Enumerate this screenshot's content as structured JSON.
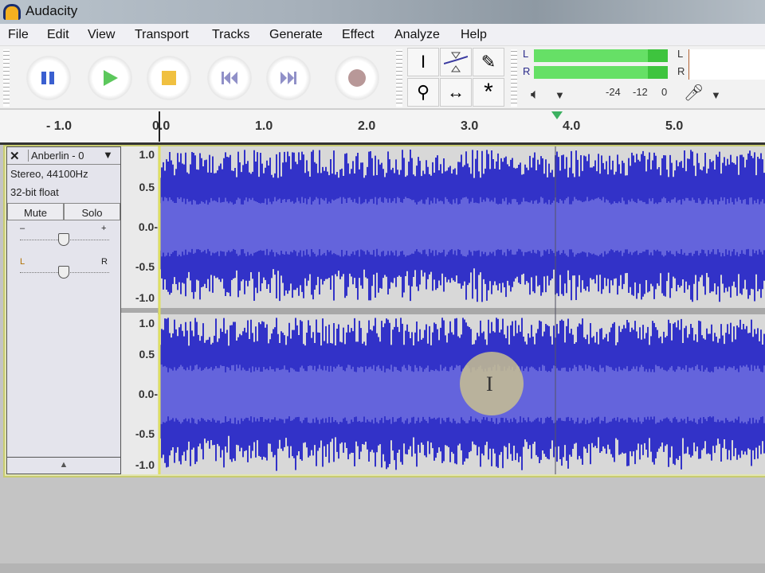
{
  "window": {
    "title": "Audacity"
  },
  "menu": [
    "File",
    "Edit",
    "View",
    "Transport",
    "Tracks",
    "Generate",
    "Effect",
    "Analyze",
    "Help"
  ],
  "transport": {
    "pause": "pause",
    "play": "play",
    "stop": "stop",
    "skip_start": "skip-to-start",
    "skip_end": "skip-to-end",
    "record": "record"
  },
  "tools": [
    "selection",
    "envelope",
    "draw",
    "zoom",
    "time-shift",
    "multi"
  ],
  "meter": {
    "play_L": "L",
    "play_R": "R",
    "rec_L": "L",
    "rec_R": "R",
    "scale": [
      "-24",
      "-12",
      "0"
    ]
  },
  "ruler": {
    "ticks": [
      "- 1.0",
      "0.0",
      "1.0",
      "2.0",
      "3.0",
      "4.0",
      "5.0"
    ]
  },
  "track": {
    "name": "Anberlin - 0",
    "format": "Stereo, 44100Hz",
    "bits": "32-bit float",
    "mute": "Mute",
    "solo": "Solo",
    "gain_minus": "–",
    "gain_plus": "+",
    "pan_L": "L",
    "pan_R": "R",
    "scale": [
      "1.0",
      "0.5",
      "0.0-",
      "-0.5",
      "-1.0"
    ]
  },
  "colors": {
    "wave": "#3232c8",
    "wave_rms": "#6464dc",
    "background": "#c4c4c4"
  }
}
